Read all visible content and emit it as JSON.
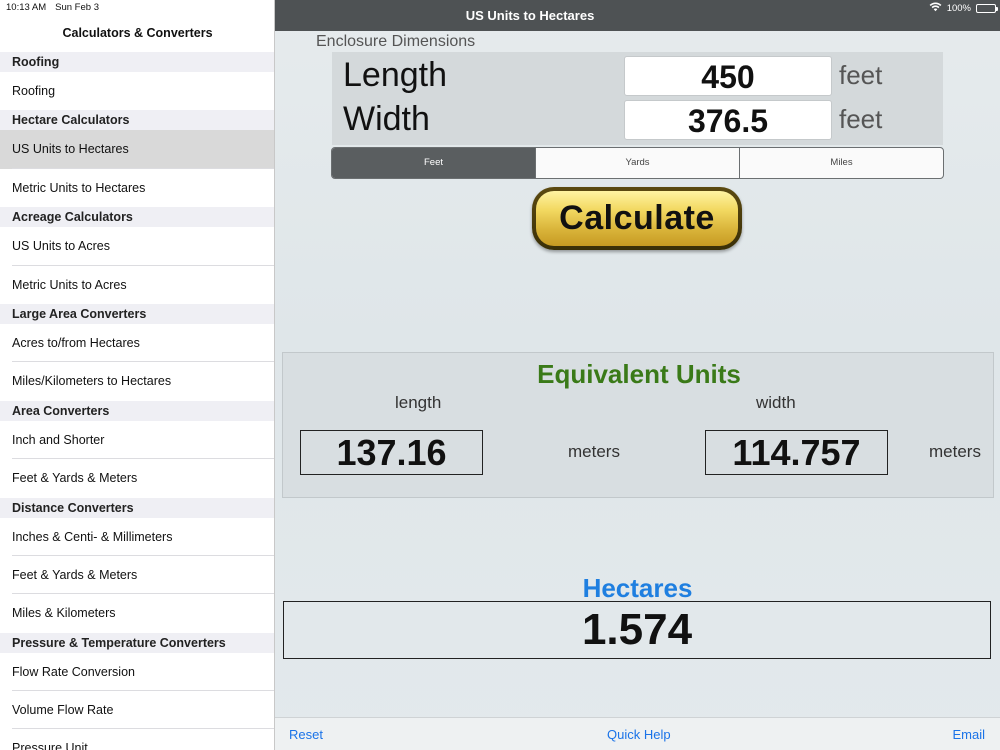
{
  "status": {
    "time": "10:13 AM",
    "date": "Sun Feb 3",
    "battery": "100%",
    "wifi_icon": "wifi-icon"
  },
  "sidebar": {
    "title": "Calculators & Converters",
    "entries": [
      {
        "type": "section",
        "label": "Roofing"
      },
      {
        "type": "item",
        "label": "Roofing"
      },
      {
        "type": "section",
        "label": "Hectare Calculators"
      },
      {
        "type": "item",
        "label": "US Units to Hectares",
        "selected": true
      },
      {
        "type": "item",
        "label": "Metric Units to Hectares"
      },
      {
        "type": "section",
        "label": "Acreage Calculators"
      },
      {
        "type": "item",
        "label": "US Units to Acres"
      },
      {
        "type": "item",
        "label": "Metric Units to Acres"
      },
      {
        "type": "section",
        "label": "Large Area Converters"
      },
      {
        "type": "item",
        "label": "Acres to/from Hectares"
      },
      {
        "type": "item",
        "label": "Miles/Kilometers to Hectares"
      },
      {
        "type": "section",
        "label": "Area Converters"
      },
      {
        "type": "item",
        "label": "Inch and Shorter"
      },
      {
        "type": "item",
        "label": "Feet & Yards & Meters"
      },
      {
        "type": "section",
        "label": "Distance Converters"
      },
      {
        "type": "item",
        "label": "Inches & Centi- & Millimeters"
      },
      {
        "type": "item",
        "label": "Feet & Yards & Meters"
      },
      {
        "type": "item",
        "label": "Miles & Kilometers"
      },
      {
        "type": "section",
        "label": "Pressure & Temperature Converters"
      },
      {
        "type": "item",
        "label": "Flow Rate Conversion"
      },
      {
        "type": "item",
        "label": "Volume Flow Rate"
      },
      {
        "type": "item",
        "label": "Pressure Unit"
      }
    ]
  },
  "header": {
    "title": "US Units to Hectares"
  },
  "enclosure": {
    "label": "Enclosure Dimensions",
    "length": {
      "label": "Length",
      "value": "450",
      "unit": "feet"
    },
    "width": {
      "label": "Width",
      "value": "376.5",
      "unit": "feet"
    }
  },
  "unit_segments": [
    {
      "label": "Feet",
      "active": true
    },
    {
      "label": "Yards",
      "active": false
    },
    {
      "label": "Miles",
      "active": false
    }
  ],
  "calculate_label": "Calculate",
  "equivalent": {
    "title": "Equivalent Units",
    "length_label": "length",
    "width_label": "width",
    "length_value": "137.16",
    "width_value": "114.757",
    "length_unit": "meters",
    "width_unit": "meters"
  },
  "hectares": {
    "title": "Hectares",
    "value": "1.574"
  },
  "toolbar": {
    "reset": "Reset",
    "quick_help": "Quick Help",
    "email": "Email"
  },
  "colors": {
    "nav_bar": "#4e5254",
    "equiv_title": "#3a7a18",
    "hectares_title": "#1f7fe0",
    "button_gold": "#e8c94d",
    "link": "#1a73e8"
  }
}
